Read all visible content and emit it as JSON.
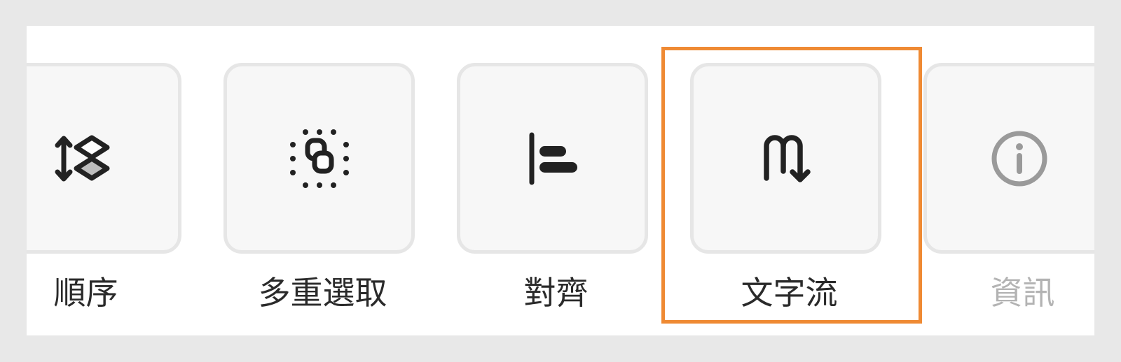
{
  "toolbar": {
    "items": [
      {
        "label": "順序",
        "icon": "layer-order-icon",
        "state": "normal"
      },
      {
        "label": "多重選取",
        "icon": "multi-select-icon",
        "state": "normal"
      },
      {
        "label": "對齊",
        "icon": "align-left-icon",
        "state": "normal"
      },
      {
        "label": "文字流",
        "icon": "text-flow-icon",
        "state": "selected"
      },
      {
        "label": "資訊",
        "icon": "info-icon",
        "state": "dimmed"
      }
    ],
    "selected_index": 3
  },
  "colors": {
    "background": "#e8e8e8",
    "panel": "#ffffff",
    "tile_fill": "#f7f7f7",
    "tile_border": "#e6e6e6",
    "icon": "#222222",
    "icon_dim": "#9a9a9a",
    "label": "#2a2a2a",
    "label_dim": "#b3b3b3",
    "selection_outline": "#ef8a33"
  }
}
